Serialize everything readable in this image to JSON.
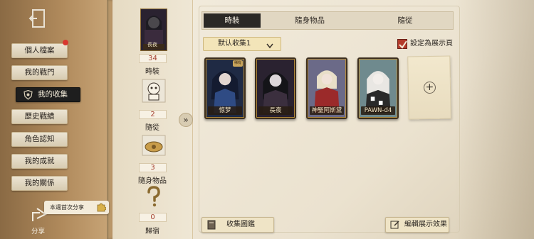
{
  "sidebar": {
    "items": [
      {
        "label": "個人檔案"
      },
      {
        "label": "我的戰門"
      },
      {
        "label": "我的收集"
      },
      {
        "label": "歷史戰績"
      },
      {
        "label": "角色認知"
      },
      {
        "label": "我的成就"
      },
      {
        "label": "我的關係"
      }
    ],
    "share_label": "分享",
    "share_tip": "本週首次分享"
  },
  "stats": {
    "costume_count": "34",
    "costume_label": "時裝",
    "follower_count": "2",
    "follower_label": "隨從",
    "accessory_count": "3",
    "accessory_label": "隨身物品",
    "home_count": "0",
    "home_label": "歸宿",
    "thumb_name": "長夜"
  },
  "tabs": [
    {
      "label": "時裝"
    },
    {
      "label": "隨身物品"
    },
    {
      "label": "隨從"
    }
  ],
  "collection_select": "默认收集1",
  "display_toggle": "設定為展示頁",
  "cards": [
    {
      "name": "惊梦",
      "badge": "稀有"
    },
    {
      "name": "長夜"
    },
    {
      "name": "神聖阿斯黛"
    },
    {
      "name": "PAWN-d4"
    }
  ],
  "buttons": {
    "album": "收集圖鑑",
    "edit_display": "編輯展示效果"
  },
  "colors": {
    "accent_red": "#b33a2a",
    "active_tab": "#2b2926",
    "paper": "#f1eadb"
  }
}
